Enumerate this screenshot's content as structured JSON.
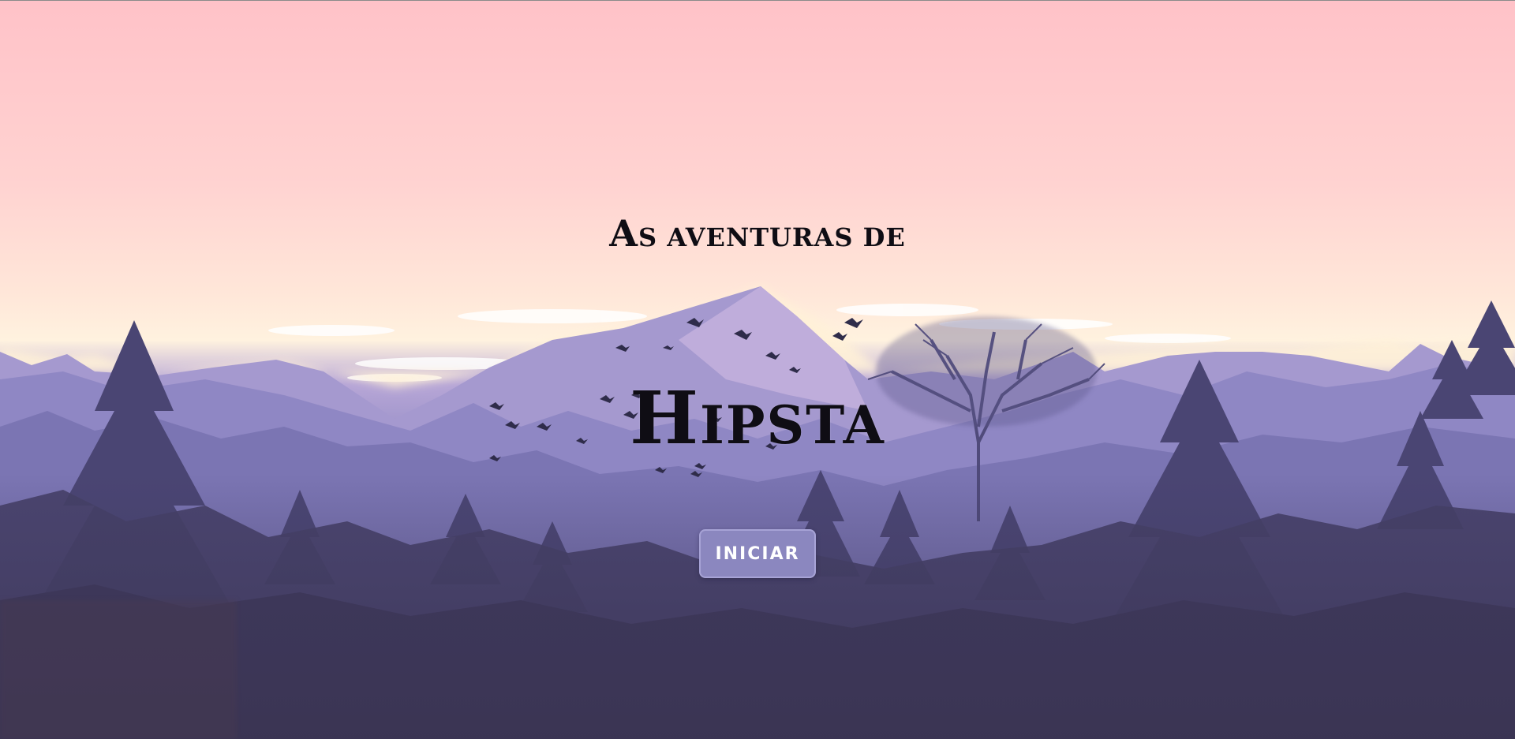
{
  "hero": {
    "subtitle_cap": "A",
    "subtitle_rest": "S AVENTURAS DE",
    "title_cap": "H",
    "title_rest": "IPSTA"
  },
  "start_button": {
    "label": "INICIAR"
  },
  "background": {
    "scene": "mountain-forest-sunset-illustration",
    "icons": [
      "mountain-icon",
      "pine-tree-icon",
      "bird-icon",
      "bare-tree-icon",
      "cloud-icon"
    ]
  },
  "colors": {
    "sky_top": "#ffc2c8",
    "button": "#8b87bf",
    "title_text": "#0f0d14",
    "forest_dark": "#3f3a5f"
  }
}
